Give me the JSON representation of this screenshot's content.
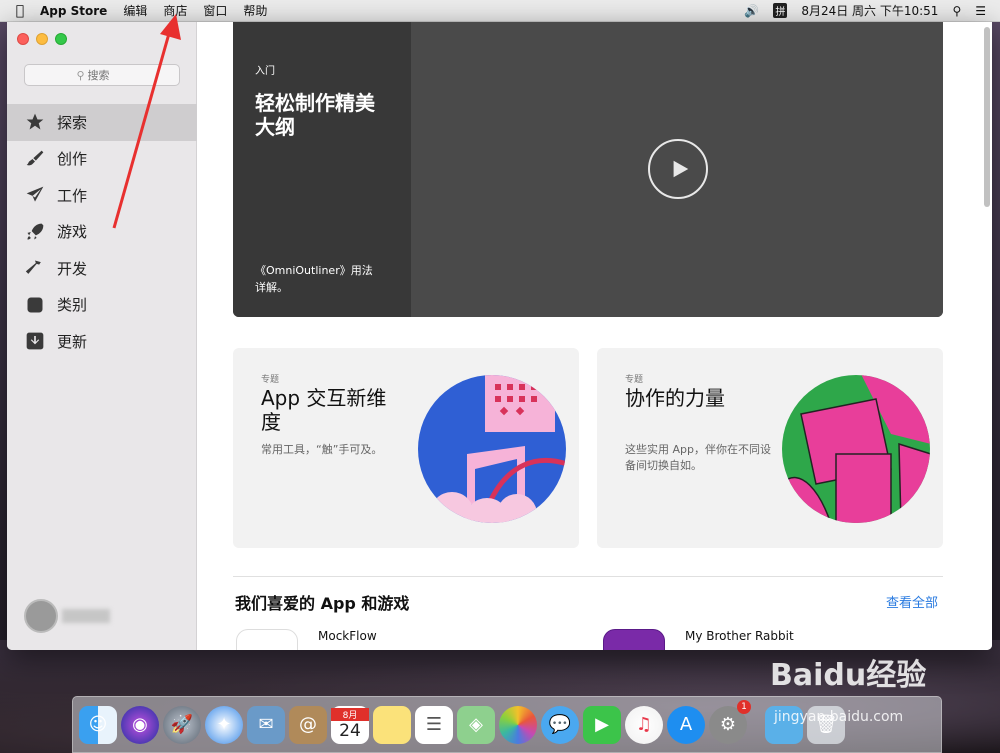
{
  "menubar": {
    "app_name": "App Store",
    "items": [
      "编辑",
      "商店",
      "窗口",
      "帮助"
    ],
    "ime_label": "拼",
    "datetime": "8月24日 周六 下午10:51"
  },
  "sidebar": {
    "search_placeholder": "搜索",
    "items": [
      {
        "label": "探索",
        "icon": "star-icon",
        "active": true
      },
      {
        "label": "创作",
        "icon": "brush-icon"
      },
      {
        "label": "工作",
        "icon": "paperplane-icon"
      },
      {
        "label": "游戏",
        "icon": "rocket-icon"
      },
      {
        "label": "开发",
        "icon": "hammer-icon"
      },
      {
        "label": "类别",
        "icon": "stack-icon"
      },
      {
        "label": "更新",
        "icon": "download-icon"
      }
    ]
  },
  "hero": {
    "category": "入门",
    "title": "轻松制作精美大纲",
    "desc": "《OmniOutliner》用法详解。"
  },
  "cards": [
    {
      "category": "专题",
      "title": "App 交互新维度",
      "subtitle": "常用工具，“触”手可及。"
    },
    {
      "category": "专题",
      "title": "协作的力量",
      "subtitle": "这些实用 App，伴你在不同设备间切换自如。"
    }
  ],
  "section": {
    "title": "我们喜爱的 App 和游戏",
    "see_all": "查看全部",
    "apps": [
      "MockFlow",
      "My Brother Rabbit"
    ]
  },
  "dock": {
    "badge_count": "1",
    "calendar_month": "8月",
    "calendar_day": "24"
  },
  "watermark": {
    "brand": "Baidu经验",
    "url": "jingyan.baidu.com"
  },
  "colors": {
    "accent_blue": "#2a7be0",
    "annotation_red": "#e8302f"
  }
}
